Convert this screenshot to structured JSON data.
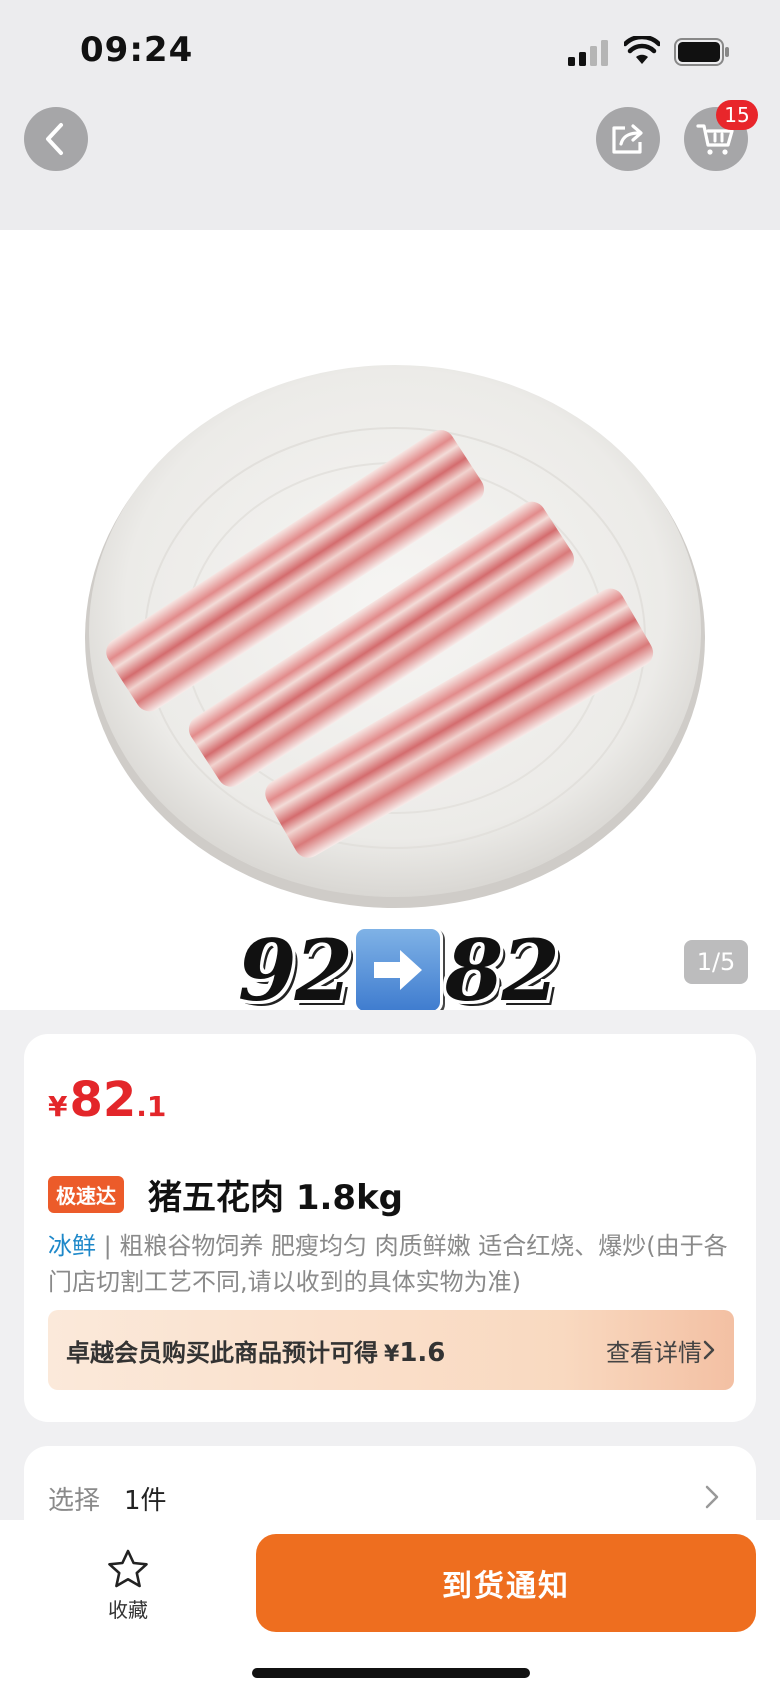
{
  "status_bar": {
    "time": "09:24"
  },
  "nav": {
    "cart_count": "15"
  },
  "gallery": {
    "promo_old": "92",
    "promo_new": "82",
    "page_counter": "1/5"
  },
  "product": {
    "price_currency": "¥",
    "price_int": "82",
    "price_dec": ".1",
    "tag": "极速达",
    "title": "猪五花肉 1.8kg",
    "desc_highlight": "冰鲜",
    "desc_text": " | 粗粮谷物饲养 肥瘦均匀 肉质鲜嫩 适合红烧、爆炒(由于各门店切割工艺不同,请以收到的具体实物为准)",
    "member_text": "卓越会员购买此商品预计可得",
    "member_currency": "¥",
    "member_value": "1.6",
    "member_link": "查看详情"
  },
  "selection": {
    "label": "选择",
    "value": "1件"
  },
  "bottom": {
    "fav_label": "收藏",
    "notify_label": "到货通知"
  },
  "colors": {
    "price": "#e3262a",
    "accent": "#ee6e1f",
    "badge": "#e8262b",
    "fresh": "#1e88c9"
  }
}
